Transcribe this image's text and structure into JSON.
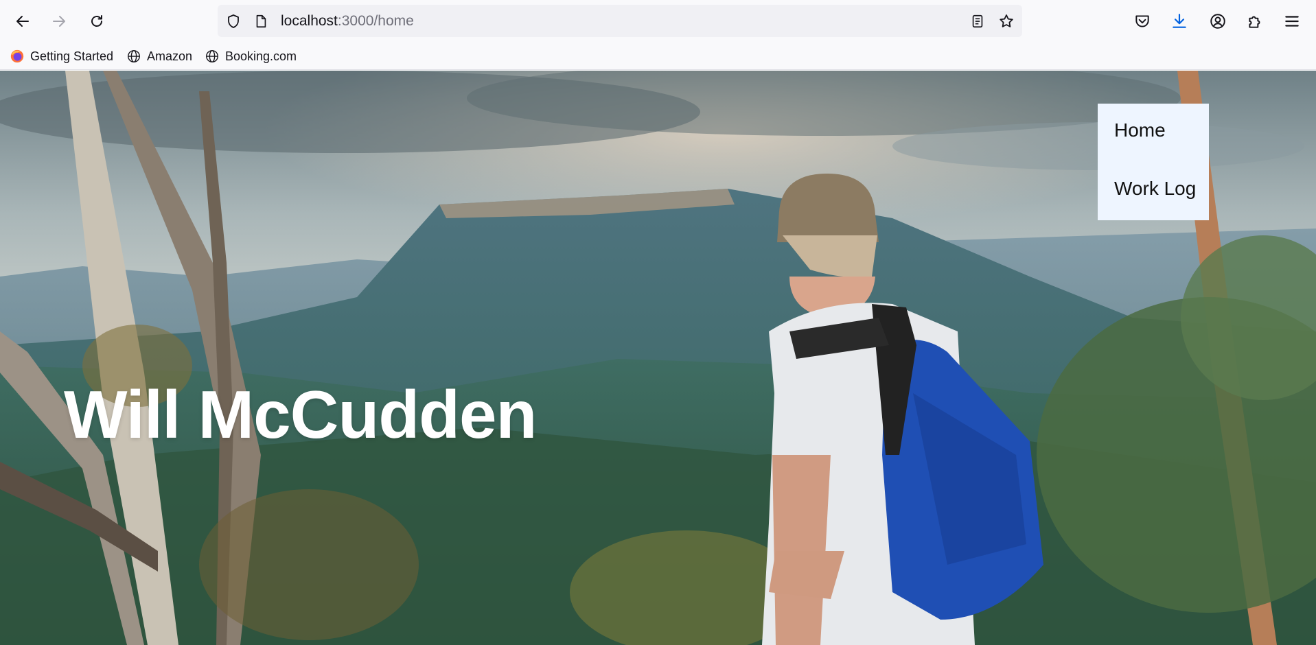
{
  "browser": {
    "url_host": "localhost",
    "url_rest": ":3000/home",
    "nav": {
      "back_icon": "arrow-left-icon",
      "forward_icon": "arrow-right-icon",
      "reload_icon": "reload-icon"
    },
    "bookmarks": [
      {
        "label": "Getting Started",
        "icon": "firefox-icon"
      },
      {
        "label": "Amazon",
        "icon": "globe-icon"
      },
      {
        "label": "Booking.com",
        "icon": "globe-icon"
      }
    ]
  },
  "page": {
    "title": "Will McCudden",
    "menu": [
      {
        "label": "Home"
      },
      {
        "label": "Work Log"
      }
    ]
  },
  "colors": {
    "chrome_bg": "#f9f9fb",
    "urlbar_bg": "#f0f0f4",
    "menu_bg": "#eef5ff",
    "download_accent": "#0061e0"
  }
}
